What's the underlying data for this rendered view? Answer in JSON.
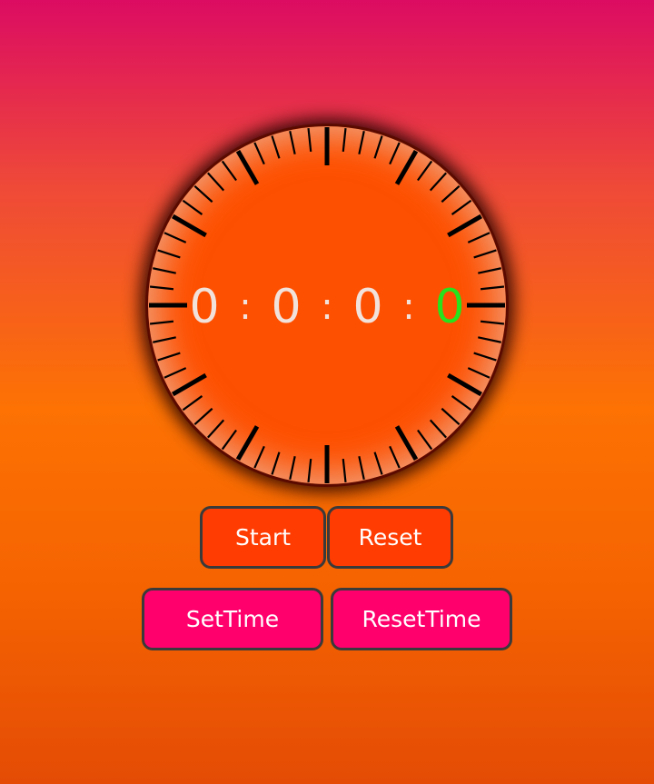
{
  "timer": {
    "hours": "0",
    "minutes": "0",
    "seconds": "0",
    "tenths": "0",
    "separator": ":"
  },
  "buttons": {
    "start_label": "Start",
    "reset_label": "Reset",
    "set_time_label": "SetTime",
    "reset_time_label": "ResetTime"
  },
  "colors": {
    "face": "#fe5001",
    "active_digit": "#27e21c",
    "digit": "#f2e2dc",
    "primary_button": "#ff3c02",
    "secondary_button": "#ff006d"
  }
}
